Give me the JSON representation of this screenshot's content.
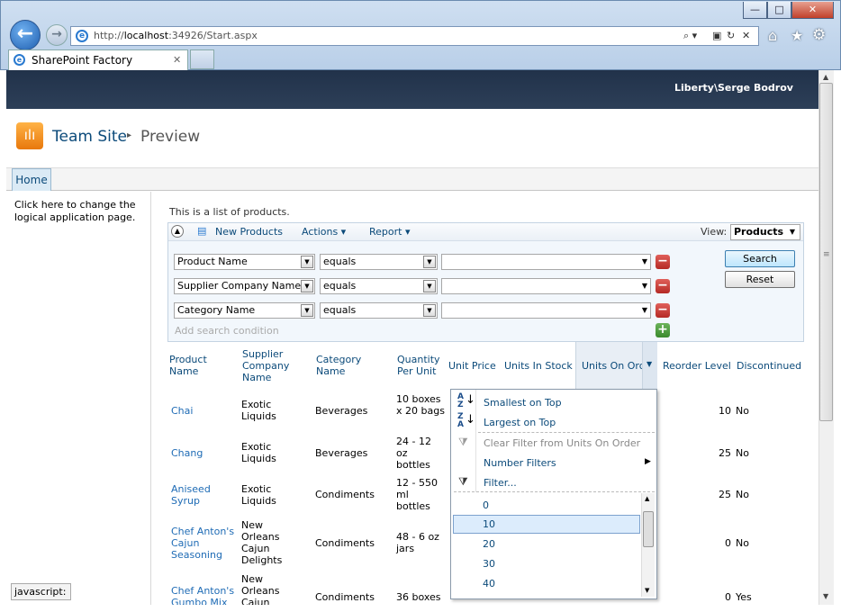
{
  "window": {
    "minimize": "—",
    "maximize": "□",
    "close": "✕"
  },
  "browser": {
    "url_prefix": "http://",
    "url_host": "localhost",
    "url_rest": ":34926/Start.aspx",
    "tab_title": "SharePoint Factory",
    "tab_close": "✕"
  },
  "header": {
    "user": "Liberty\\Serge Bodrov",
    "site_title": "Team Site",
    "separator": "▸",
    "page_title": "Preview"
  },
  "nav": {
    "home": "Home"
  },
  "leftnav": {
    "text": "Click here to change the logical application page."
  },
  "list": {
    "description": "This is a list of products."
  },
  "toolbar": {
    "new_products": "New Products",
    "actions": "Actions",
    "report": "Report",
    "view_label": "View:",
    "view_value": "Products"
  },
  "search": {
    "rows": [
      {
        "field": "Product Name",
        "op": "equals",
        "value": ""
      },
      {
        "field": "Supplier Company Name",
        "op": "equals",
        "value": ""
      },
      {
        "field": "Category Name",
        "op": "equals",
        "value": ""
      }
    ],
    "add_condition": "Add search condition",
    "search_btn": "Search",
    "reset_btn": "Reset"
  },
  "columns": {
    "product": "Product Name",
    "supplier": "Supplier Company Name",
    "category": "Category Name",
    "qty": "Quantity Per Unit",
    "price": "Unit Price",
    "stock": "Units In Stock",
    "order": "Units On Ord",
    "reorder": "Reorder Level",
    "disc": "Discontinued"
  },
  "rows": [
    {
      "product": "Chai",
      "supplier": "Exotic Liquids",
      "category": "Beverages",
      "qty": "10 boxes x 20 bags",
      "reorder": "10",
      "disc": "No"
    },
    {
      "product": "Chang",
      "supplier": "Exotic Liquids",
      "category": "Beverages",
      "qty": "24 - 12 oz bottles",
      "reorder": "25",
      "disc": "No"
    },
    {
      "product": "Aniseed Syrup",
      "supplier": "Exotic Liquids",
      "category": "Condiments",
      "qty": "12 - 550 ml bottles",
      "reorder": "25",
      "disc": "No"
    },
    {
      "product": "Chef Anton's Cajun Seasoning",
      "supplier": "New Orleans Cajun Delights",
      "category": "Condiments",
      "qty": "48 - 6 oz jars",
      "reorder": "0",
      "disc": "No"
    },
    {
      "product": "Chef Anton's Gumbo Mix",
      "supplier": "New Orleans Cajun",
      "category": "Condiments",
      "qty": "36 boxes",
      "reorder": "0",
      "disc": "Yes"
    }
  ],
  "menu": {
    "smallest": "Smallest on Top",
    "largest": "Largest on Top",
    "clear": "Clear Filter from Units On Order",
    "number_filters": "Number Filters",
    "filter": "Filter...",
    "values": [
      "0",
      "10",
      "20",
      "30",
      "40"
    ]
  },
  "status": "javascript:"
}
